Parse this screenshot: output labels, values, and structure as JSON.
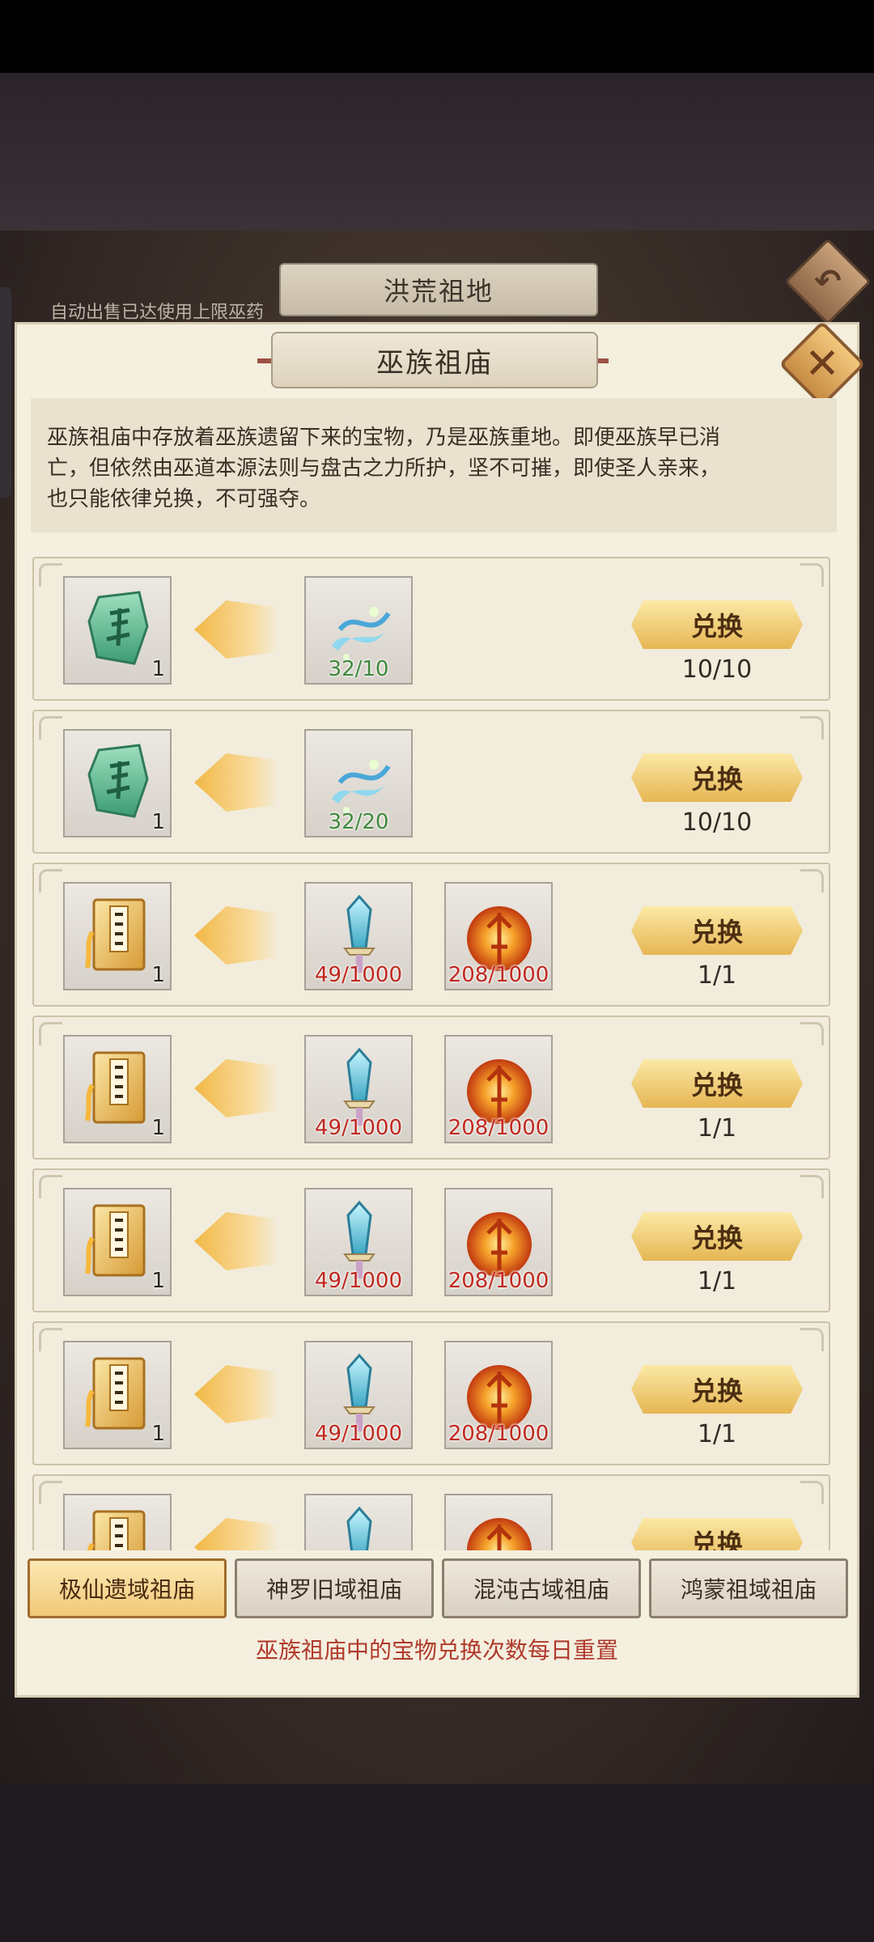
{
  "outer": {
    "title": "洪荒祖地",
    "notice": "自动出售已达使用上限巫药"
  },
  "panel": {
    "title": "巫族祖庙",
    "description_lines": [
      "巫族祖庙中存放着巫族遗留下来的宝物，乃是巫族重地。即便巫族早已消",
      "亡，但依然由巫道本源法则与盘古之力所护，坚不可摧，即使圣人亲来，",
      "也只能依律兑换，不可强夺。"
    ],
    "exchange_label": "兑换"
  },
  "rows": [
    {
      "reward_icon": "jade-token-icon",
      "reward_count": "1",
      "costs": [
        {
          "icon": "spirit-wisp-icon",
          "text": "32/10",
          "status": "ok"
        }
      ],
      "limit": "10/10"
    },
    {
      "reward_icon": "jade-token-icon",
      "reward_count": "1",
      "costs": [
        {
          "icon": "spirit-wisp-icon",
          "text": "32/20",
          "status": "ok"
        }
      ],
      "limit": "10/10"
    },
    {
      "reward_icon": "technique-book-icon",
      "reward_count": "1",
      "costs": [
        {
          "icon": "sword-icon",
          "text": "49/1000",
          "status": "bad"
        },
        {
          "icon": "fire-orb-icon",
          "text": "208/1000",
          "status": "bad"
        }
      ],
      "limit": "1/1"
    },
    {
      "reward_icon": "technique-book-icon",
      "reward_count": "1",
      "costs": [
        {
          "icon": "sword-icon",
          "text": "49/1000",
          "status": "bad"
        },
        {
          "icon": "fire-orb-icon",
          "text": "208/1000",
          "status": "bad"
        }
      ],
      "limit": "1/1"
    },
    {
      "reward_icon": "technique-book-icon",
      "reward_count": "1",
      "costs": [
        {
          "icon": "sword-icon",
          "text": "49/1000",
          "status": "bad"
        },
        {
          "icon": "fire-orb-icon",
          "text": "208/1000",
          "status": "bad"
        }
      ],
      "limit": "1/1"
    },
    {
      "reward_icon": "technique-book-icon",
      "reward_count": "1",
      "costs": [
        {
          "icon": "sword-icon",
          "text": "49/1000",
          "status": "bad"
        },
        {
          "icon": "fire-orb-icon",
          "text": "208/1000",
          "status": "bad"
        }
      ],
      "limit": "1/1"
    },
    {
      "reward_icon": "technique-book-icon",
      "reward_count": "",
      "costs": [
        {
          "icon": "sword-icon",
          "text": "",
          "status": "bad"
        },
        {
          "icon": "fire-orb-icon",
          "text": "",
          "status": "bad"
        }
      ],
      "limit": ""
    }
  ],
  "tabs": [
    {
      "label": "极仙遗域祖庙",
      "active": true
    },
    {
      "label": "神罗旧域祖庙",
      "active": false
    },
    {
      "label": "混沌古域祖庙",
      "active": false
    },
    {
      "label": "鸿蒙祖域祖庙",
      "active": false
    }
  ],
  "footer_note": "巫族祖庙中的宝物兑换次数每日重置",
  "colors": {
    "accent": "#f1c878",
    "need_ok": "#3f8a3c",
    "need_bad": "#c0281f",
    "footer": "#b03a2c"
  }
}
